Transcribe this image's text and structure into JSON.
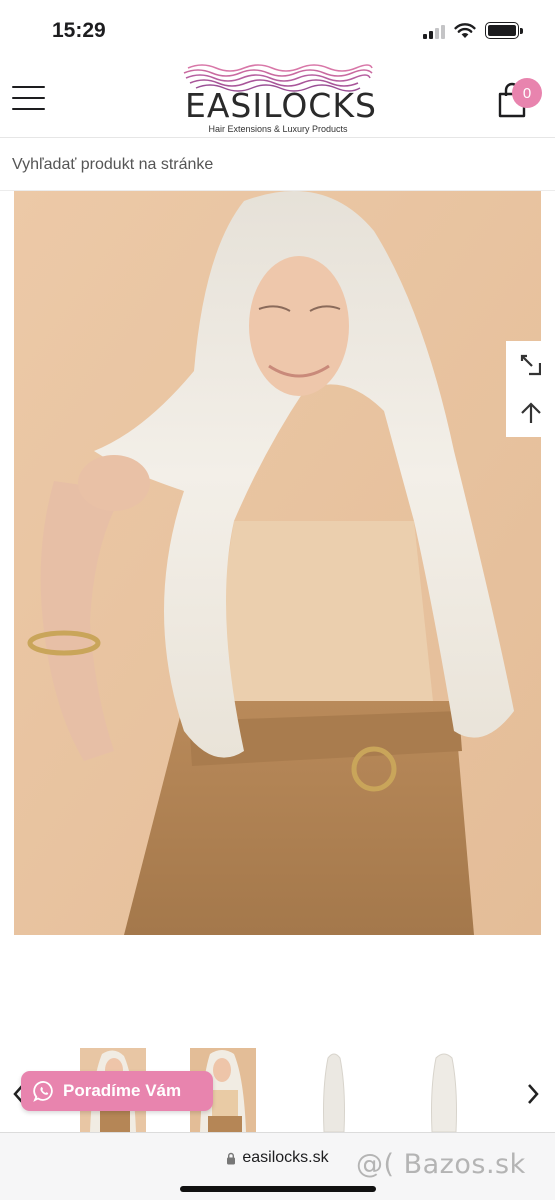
{
  "status": {
    "time": "15:29"
  },
  "header": {
    "logo_text": "EASILOCKS",
    "logo_tagline": "Hair Extensions & Luxury Products",
    "cart_count": "0",
    "brand_color": "#e884ae"
  },
  "search": {
    "placeholder": "Vyhľadať produkt na stránke"
  },
  "product": {
    "side_actions": [
      "expand-icon",
      "arrow-up-icon"
    ],
    "thumbnails": 4
  },
  "help_button": {
    "label": "Poradíme Vám",
    "icon": "whatsapp-icon"
  },
  "browser": {
    "url": "easilocks.sk",
    "watermark": "@( Bazos.sk"
  }
}
